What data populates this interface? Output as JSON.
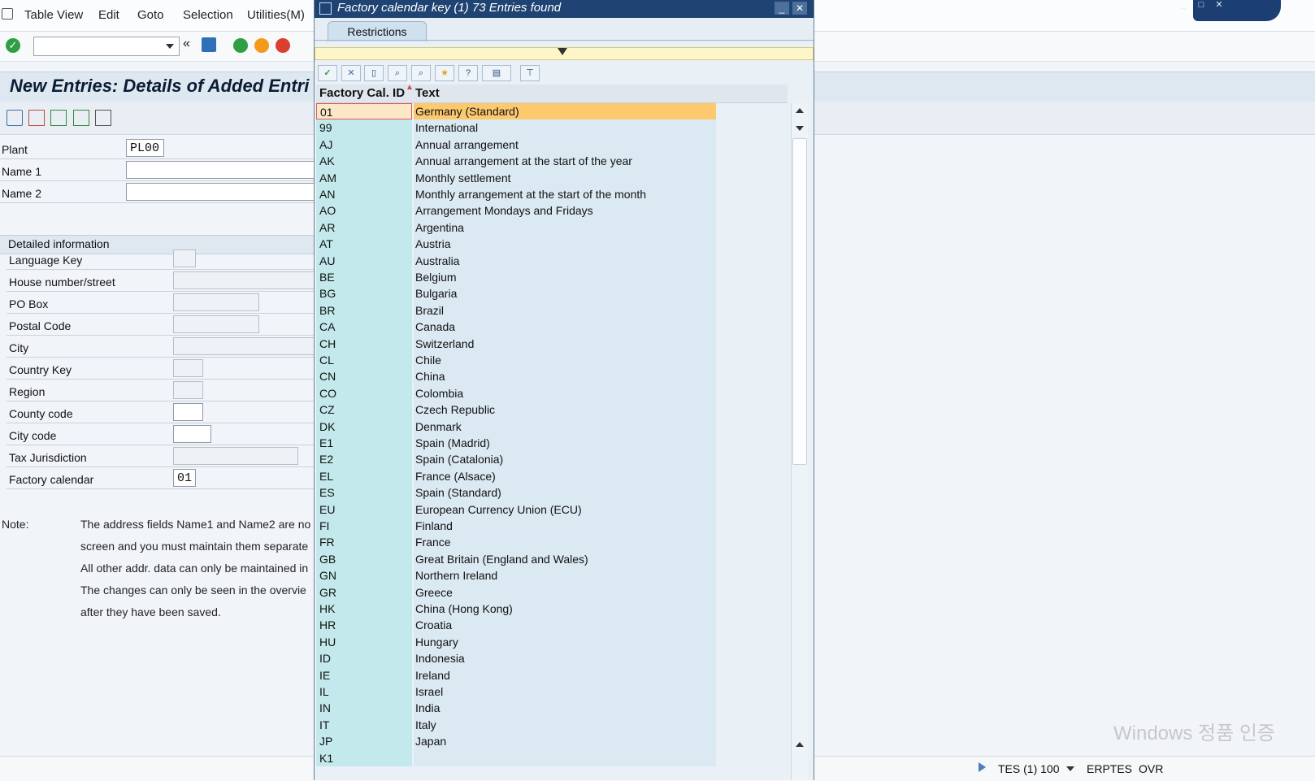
{
  "menu": [
    "Table View",
    "Edit",
    "Goto",
    "Selection",
    "Utilities(M)"
  ],
  "page_title": "New Entries: Details of Added Entri",
  "form": {
    "plant_label": "Plant",
    "plant_value": "PL00",
    "name1_label": "Name 1",
    "name2_label": "Name 2",
    "detail_title": "Detailed information",
    "fields": [
      {
        "label": "Language Key",
        "value": ""
      },
      {
        "label": "House number/street",
        "value": ""
      },
      {
        "label": "PO Box",
        "value": ""
      },
      {
        "label": "Postal Code",
        "value": ""
      },
      {
        "label": "City",
        "value": ""
      },
      {
        "label": "Country Key",
        "value": ""
      },
      {
        "label": "Region",
        "value": ""
      },
      {
        "label": "County code",
        "value": ""
      },
      {
        "label": "City code",
        "value": ""
      },
      {
        "label": "Tax Jurisdiction",
        "value": ""
      },
      {
        "label": "Factory calendar",
        "value": "01"
      }
    ],
    "note_label": "Note:",
    "note_lines": [
      "The address fields Name1 and Name2 are no",
      "screen and you must maintain them separate",
      "All other addr. data can only be maintained in",
      "The changes can only be seen in the overvie",
      "after they have been saved."
    ]
  },
  "popup": {
    "title": "Factory calendar key (1)   73 Entries found",
    "tab": "Restrictions",
    "col_id": "Factory Cal. ID",
    "col_text": "Text",
    "rows": [
      {
        "id": "01",
        "text": "Germany (Standard)",
        "selected": true
      },
      {
        "id": "99",
        "text": "International"
      },
      {
        "id": "AJ",
        "text": "Annual arrangement"
      },
      {
        "id": "AK",
        "text": "Annual arrangement at the start of the year"
      },
      {
        "id": "AM",
        "text": "Monthly settlement"
      },
      {
        "id": "AN",
        "text": "Monthly arrangement at the start of the month"
      },
      {
        "id": "AO",
        "text": "Arrangement Mondays and Fridays"
      },
      {
        "id": "AR",
        "text": "Argentina"
      },
      {
        "id": "AT",
        "text": "Austria"
      },
      {
        "id": "AU",
        "text": "Australia"
      },
      {
        "id": "BE",
        "text": "Belgium"
      },
      {
        "id": "BG",
        "text": "Bulgaria"
      },
      {
        "id": "BR",
        "text": "Brazil"
      },
      {
        "id": "CA",
        "text": "Canada"
      },
      {
        "id": "CH",
        "text": "Switzerland"
      },
      {
        "id": "CL",
        "text": "Chile"
      },
      {
        "id": "CN",
        "text": "China"
      },
      {
        "id": "CO",
        "text": "Colombia"
      },
      {
        "id": "CZ",
        "text": "Czech Republic"
      },
      {
        "id": "DK",
        "text": "Denmark"
      },
      {
        "id": "E1",
        "text": "Spain (Madrid)"
      },
      {
        "id": "E2",
        "text": "Spain (Catalonia)"
      },
      {
        "id": "EL",
        "text": "France (Alsace)"
      },
      {
        "id": "ES",
        "text": "Spain (Standard)"
      },
      {
        "id": "EU",
        "text": "European Currency Union (ECU)"
      },
      {
        "id": "FI",
        "text": "Finland"
      },
      {
        "id": "FR",
        "text": "France"
      },
      {
        "id": "GB",
        "text": "Great Britain (England and Wales)"
      },
      {
        "id": "GN",
        "text": "Northern Ireland"
      },
      {
        "id": "GR",
        "text": "Greece"
      },
      {
        "id": "HK",
        "text": "China (Hong Kong)"
      },
      {
        "id": "HR",
        "text": "Croatia"
      },
      {
        "id": "HU",
        "text": "Hungary"
      },
      {
        "id": "ID",
        "text": "Indonesia"
      },
      {
        "id": "IE",
        "text": "Ireland"
      },
      {
        "id": "IL",
        "text": "Israel"
      },
      {
        "id": "IN",
        "text": "India"
      },
      {
        "id": "IT",
        "text": "Italy"
      },
      {
        "id": "JP",
        "text": "Japan"
      },
      {
        "id": "K1",
        "text": ""
      }
    ]
  },
  "status": {
    "system": "TES (1) 100",
    "server": "ERPTES",
    "mode": "OVR"
  },
  "watermark": "Windows 정품 인증"
}
